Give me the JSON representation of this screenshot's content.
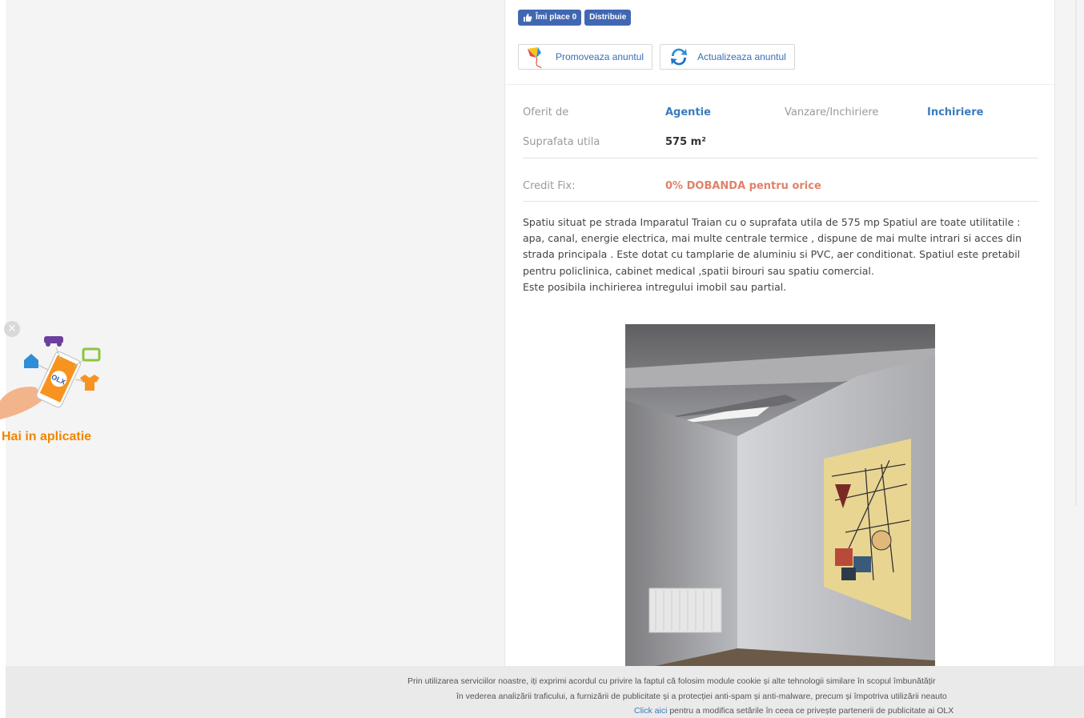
{
  "social": {
    "like_label": "Îmi place 0",
    "share_label": "Distribuie"
  },
  "actions": {
    "promote_label": "Promoveaza anuntul",
    "refresh_label": "Actualizeaza anuntul"
  },
  "attributes": [
    {
      "label": "Oferit de",
      "value": "Agentie"
    },
    {
      "label": "Vanzare/Inchiriere",
      "value": "Inchiriere"
    },
    {
      "label": "Suprafata utila",
      "value": "575 m²"
    }
  ],
  "credit": {
    "label": "Credit Fix:",
    "value": "0% DOBANDA pentru orice"
  },
  "description": {
    "paragraph1": "Spatiu situat pe strada Imparatul Traian cu o suprafata utila de 575 mp Spatiul are toate utilitatile : apa, canal, energie electrica, mai multe centrale termice , dispune de mai multe intrari si acces din strada principala . Este dotat cu tamplarie de aluminiu si PVC, aer conditionat. Spatiul este pretabil pentru policlinica, cabinet medical ,spatii birouri sau spatiu comercial.",
    "paragraph2": "Este posibila inchirierea intregului imobil sau partial."
  },
  "app_promo": {
    "label": "Hai in aplicatie",
    "close_glyph": "×",
    "logo_text": "OLX"
  },
  "cookie": {
    "line1": "Prin utilizarea serviciilor noastre, iți exprimi acordul cu privire la faptul că folosim module cookie și alte tehnologii similare în scopul îmbunătățir",
    "line2": "în vederea analizării traficului, a furnizării de publicitate și a protecției anti-spam și anti-malware, precum și împotriva utilizării neauto",
    "link": "Click aici",
    "line3_rest": " pentru a modifica setările în ceea ce privește partenerii de publicitate ai OLX"
  },
  "colors": {
    "accent_blue": "#3a7bbd",
    "facebook_blue": "#4267b2",
    "credit_red": "#e0826a",
    "olx_orange": "#f08600"
  }
}
